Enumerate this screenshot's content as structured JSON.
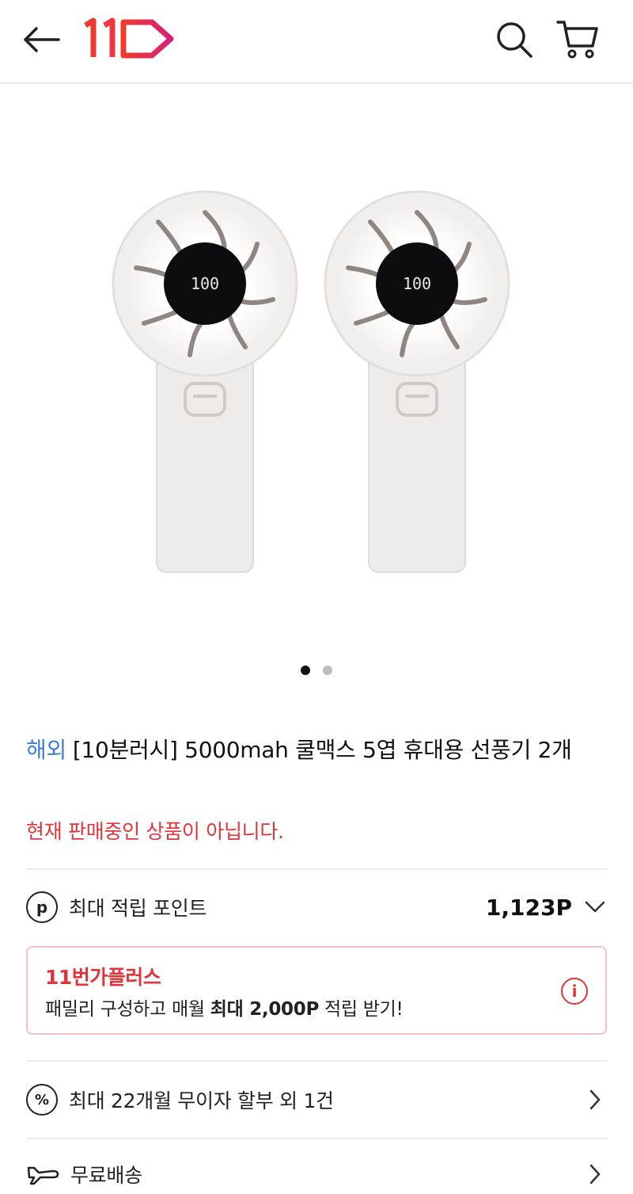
{
  "header": {
    "back_icon": "arrow-left-icon",
    "logo_text": "11",
    "search_icon": "search-icon",
    "cart_icon": "cart-icon",
    "brand_colors": [
      "#e8382d",
      "#d81f79"
    ]
  },
  "gallery": {
    "image": "two white handheld fans with digital display reading 100",
    "display_text": "100",
    "page_count": 2,
    "active_page": 1
  },
  "product": {
    "tag": "해외",
    "title": "[10분러시] 5000mah 쿨맥스 5엽 휴대용 선풍기 2개",
    "status": "현재 판매중인 상품이 아닙니다."
  },
  "points": {
    "icon": "p",
    "label": "최대 적립 포인트",
    "value": "1,123P"
  },
  "plus": {
    "title": "11번가플러스",
    "desc_prefix": "패밀리 구성하고 매월 ",
    "desc_bold": "최대 2,000P",
    "desc_suffix": " 적립 받기!",
    "info_icon": "i"
  },
  "installment": {
    "icon": "%",
    "label": "최대 22개월 무이자 할부 외 1건"
  },
  "shipping": {
    "label": "무료배송"
  },
  "colors": {
    "accent_red": "#e0353b",
    "tag_blue": "#3f7fd0"
  }
}
